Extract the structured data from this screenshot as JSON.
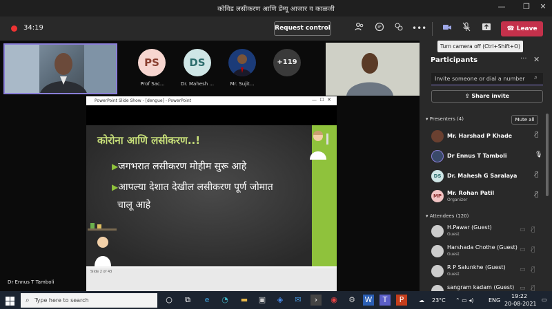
{
  "window": {
    "title": "कोविड लसीकरण आणि डेंग्यू आजार व काळजी",
    "controls": [
      "—",
      "❐",
      "✕"
    ]
  },
  "meeting_bar": {
    "timer": "34:19",
    "request_control": "Request control",
    "leave": "Leave",
    "tooltip": "Turn camera off (Ctrl+Shift+O)"
  },
  "videos": {
    "speaker": "Dr Ennus T Tamboli",
    "tiles": [
      {
        "initials": "PS",
        "name": "Prof Sac...",
        "bg": "#f7d6d0",
        "fg": "#8a3f30"
      },
      {
        "initials": "DS",
        "name": "Dr. Mahesh ...",
        "bg": "#cfe6e6",
        "fg": "#2d6d6d"
      },
      {
        "initials": "",
        "name": "Mr. Sujit...",
        "bg": "#1b3b78",
        "fg": "#fff"
      }
    ],
    "more": "+119"
  },
  "shared": {
    "window_title": "PowerPoint Slide Show - [dengue] - PowerPoint",
    "slide_title": "कोरोना आणि लसीकरण..!",
    "bullets": [
      "जगभरात लसीकरण मोहीम सुरू आहे",
      "आपल्या देशात देखील लसीकरण पूर्ण जोमात",
      "चालू आहे"
    ],
    "status": "Slide 2 of 43"
  },
  "participants": {
    "title": "Participants",
    "invite_placeholder": "Invite someone or dial a number",
    "share_invite": "Share invite",
    "presenters_label": "Presenters (4)",
    "mute_all": "Mute all",
    "presenters": [
      {
        "initials": "",
        "name": "Mr. Harshad P Khade",
        "sub": "",
        "bg": "#6a4030"
      },
      {
        "initials": "",
        "name": "Dr Ennus T Tamboli",
        "sub": "",
        "bg": "#3a4a6a"
      },
      {
        "initials": "DS",
        "name": "Dr. Mahesh G Saralaya",
        "sub": "",
        "bg": "#cfe6e6"
      },
      {
        "initials": "MP",
        "name": "Mr. Rohan Patil",
        "sub": "Organizer",
        "bg": "#f2c4c4"
      }
    ],
    "attendees_label": "Attendees (120)",
    "attendees": [
      {
        "name": "H.Pawar (Guest)",
        "sub": "Guest"
      },
      {
        "name": "Harshada Chothe (Guest)",
        "sub": "Guest"
      },
      {
        "name": "R P Salunkhe (Guest)",
        "sub": "Guest"
      },
      {
        "name": "sangram kadam (Guest)",
        "sub": ""
      }
    ]
  },
  "taskbar": {
    "search_placeholder": "Type here to search",
    "temperature": "23°C",
    "lang": "ENG",
    "time": "19:22",
    "date": "20-08-2021"
  }
}
